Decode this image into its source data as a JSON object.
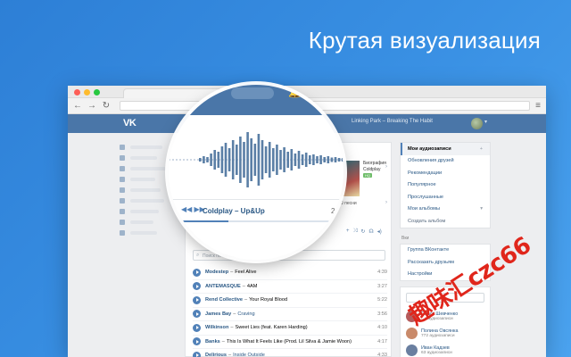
{
  "headline": "Крутая визуализация",
  "vk": {
    "logo": "VK",
    "now_playing": "Linking Park – Breaking The Habit"
  },
  "player": {
    "track_label": "Coldplay – Up&Up",
    "time": "2:",
    "progress": 0.3,
    "side_title": "Биография",
    "side_artist": "Coldplay",
    "side_badge": "HQ",
    "side_song": "Ω песни",
    "search_placeholder": "Поиск по записям"
  },
  "tracks": [
    {
      "artist": "Modestep",
      "title": "Feel Alive",
      "link": false,
      "duration": "4:39"
    },
    {
      "artist": "ANTEMASQUE",
      "title": "4AM",
      "link": false,
      "duration": "3:27"
    },
    {
      "artist": "Rend Collective",
      "title": "Your Royal Blood",
      "link": false,
      "duration": "5:22"
    },
    {
      "artist": "James Bay",
      "title": "Craving",
      "link": true,
      "duration": "3:56"
    },
    {
      "artist": "Wilkinson",
      "title": "Sweet Lies (feat. Karen Harding)",
      "link": false,
      "duration": "4:10"
    },
    {
      "artist": "Banks",
      "title": "This Is What It Feels Like (Prod. Lil Silva & Jamie Woon)",
      "link": false,
      "duration": "4:17"
    },
    {
      "artist": "Delirious",
      "title": "Inside Outside",
      "link": true,
      "duration": "4:33"
    }
  ],
  "sidebar": {
    "items": [
      {
        "label": "Мои аудиозаписи",
        "active": true
      },
      {
        "label": "Обновления друзей",
        "active": false
      },
      {
        "label": "Рекомендации",
        "active": false
      },
      {
        "label": "Популярное",
        "active": false
      },
      {
        "label": "Прослушанные",
        "active": false
      },
      {
        "label": "Мои альбомы",
        "active": false
      }
    ],
    "create_album": "Создать альбом",
    "vk_label": "Вки",
    "vk_items": [
      "Группа ВКонтакте",
      "Рассказать друзьям",
      "Настройки"
    ]
  },
  "friends": [
    {
      "name": "Ольга Шевченко",
      "sub": "...з аудиозаписи"
    },
    {
      "name": "Полина Овсянка",
      "sub": "772 аудиозаписи"
    },
    {
      "name": "Иван Кадзев",
      "sub": "63 аудиозаписи"
    }
  ],
  "watermark": "趣味汇czc66",
  "colors": {
    "brand": "#4a76a8",
    "accent": "#5181b8",
    "link": "#2a5885",
    "background": "#3a91e4"
  }
}
